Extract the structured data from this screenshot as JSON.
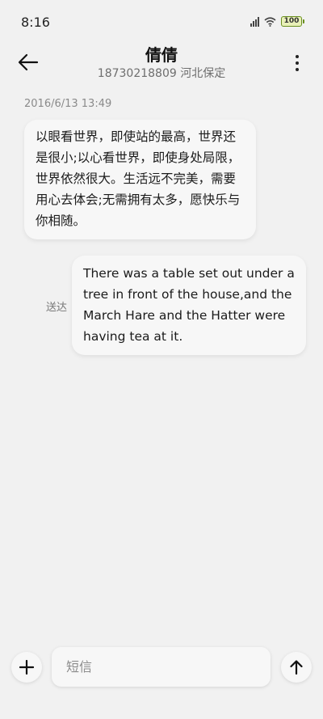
{
  "status_bar": {
    "time": "8:16",
    "battery": "100",
    "icons": [
      "signal-icon",
      "wifi-icon",
      "battery-icon"
    ]
  },
  "header": {
    "contact_name": "倩倩",
    "contact_number_location": "18730218809 河北保定",
    "back_icon": "arrow-left-icon",
    "more_icon": "more-vertical-icon"
  },
  "conversation": {
    "timestamp": "2016/6/13 13:49",
    "messages": [
      {
        "direction": "incoming",
        "text": "以眼看世界，即使站的最高，世界还是很小;以心看世界，即使身处局限，世界依然很大。生活远不完美，需要用心去体会;无需拥有太多，愿快乐与你相随。"
      },
      {
        "direction": "outgoing",
        "text": "There was a table set out under a tree in front of the house,and the March Hare and the Hatter were having tea at it.",
        "status": "送达"
      }
    ]
  },
  "composer": {
    "placeholder": "短信",
    "value": "",
    "add_icon": "plus-icon",
    "send_icon": "arrow-up-icon"
  }
}
